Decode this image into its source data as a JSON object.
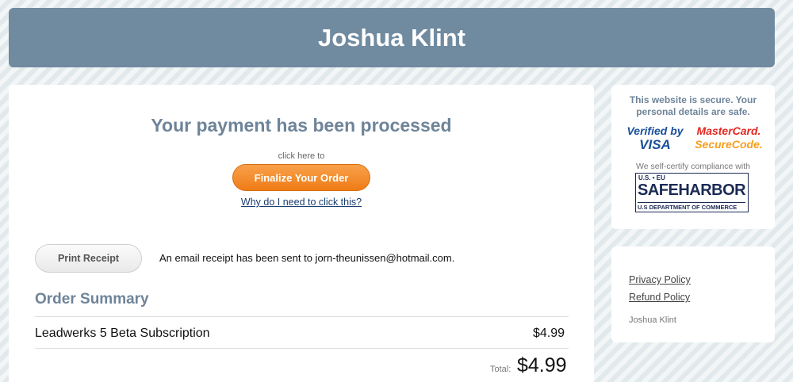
{
  "header": {
    "title": "Joshua Klint"
  },
  "main": {
    "processed_title": "Your payment has been processed",
    "click_here": "click here to",
    "finalize_label": "Finalize Your Order",
    "why_link": "Why do I need to click this?",
    "print_label": "Print Receipt",
    "email_note": "An email receipt has been sent to jorn-theunissen@hotmail.com.",
    "summary_title": "Order Summary",
    "items": [
      {
        "name": "Leadwerks 5 Beta Subscription",
        "price": "$4.99"
      }
    ],
    "total_label": "Total:",
    "total_value": "$4.99"
  },
  "sidebar": {
    "secure_text": "This website is secure. Your personal details are safe.",
    "visa_line1": "Verified by",
    "visa_line2": "VISA",
    "mc_line1": "MasterCard.",
    "mc_line2": "SecureCode.",
    "selfcert": "We self-certify compliance with",
    "sh_top": "U.S. • EU",
    "sh_main": "SAFEHARBOR",
    "sh_bottom": "U.S DEPARTMENT OF COMMERCE",
    "links": [
      "Privacy Policy",
      "Refund Policy"
    ],
    "owner": "Joshua Klint"
  },
  "colors": {
    "header_bg": "#708a9f",
    "accent_orange": "#ef7c17",
    "title_blue": "#6e8499"
  }
}
